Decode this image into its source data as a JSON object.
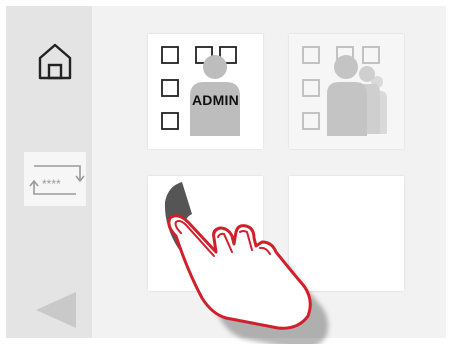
{
  "sidebar": {
    "items": [
      {
        "name": "home",
        "icon": "home-icon"
      },
      {
        "name": "pin-code",
        "icon": "keypad-pin-icon",
        "label": "****"
      },
      {
        "name": "back",
        "icon": "back-arrow-icon"
      }
    ]
  },
  "tiles": {
    "admin": {
      "icon": "admin-user-icon",
      "label": "ADMIN"
    },
    "users": {
      "icon": "user-group-icon"
    },
    "call": {
      "icon": "phone-handset-icon"
    },
    "empty": {}
  },
  "overlay": {
    "icon": "tapping-hand-icon"
  },
  "colors": {
    "sidebar_bg": "#e4e4e4",
    "screen_bg": "#f2f2f2",
    "tile_bg": "#ffffff",
    "icon_dark": "#555555",
    "icon_light": "#cfcfcf",
    "hand_outline": "#d0202c"
  }
}
